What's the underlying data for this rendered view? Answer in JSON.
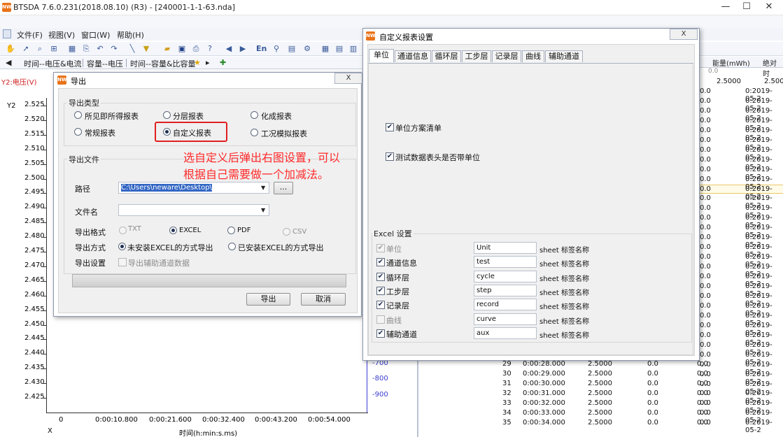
{
  "app": {
    "title": "BTSDA 7.6.0.231(2018.08.10) (R3) - [240001-1-1-63.nda]",
    "icon_text": "NW",
    "menu": [
      "文件(F)",
      "视图(V)",
      "窗口(W)",
      "帮助(H)"
    ],
    "toolbar_en": "En"
  },
  "tabs": [
    "时间--电压&电流",
    "容量--电压",
    "时间--容量&比容量"
  ],
  "graph": {
    "y_title": "Y2:电压(V)",
    "y_label": "Y2",
    "yticks": [
      "2.525",
      "2.520",
      "2.515",
      "2.510",
      "2.505",
      "2.500",
      "2.495",
      "2.490",
      "2.485",
      "2.480",
      "2.475",
      "2.470",
      "2.465",
      "2.460",
      "2.455",
      "2.450",
      "2.445",
      "2.440",
      "2.435",
      "2.430",
      "2.425"
    ],
    "right_ticks": [
      "-700",
      "-800",
      "-900"
    ],
    "xticks": [
      "0",
      "0:00:10.800",
      "0:00:21.600",
      "0:00:32.400",
      "0:00:43.200",
      "0:00:54.000"
    ],
    "x_title": "时间(h:min:s.ms)",
    "x_corner": "X"
  },
  "table": {
    "headers": [
      "能量(mWh)",
      "绝对时"
    ],
    "first_row": {
      "energy": "0.0"
    },
    "second_row": {
      "voltage": "2.5000"
    },
    "date_prefix": "0.0",
    "date_cells": [
      "0:2019-05-2",
      "0:2019-05-2",
      "0:2019-05-2",
      "0:2019-05-2",
      "0:2019-05-2",
      "0:2019-05-2",
      "0:2019-05-2",
      "0:2019-05-2",
      "0:2019-05-2",
      "0:2019-05-2",
      "0:2019-05-2",
      "0:2019-05-2",
      "0:2019-05-2",
      "0:2019-05-2",
      "0:2019-05-2",
      "0:2019-05-2",
      "0:2019-05-2",
      "0:2019-05-2",
      "0:2019-05-2",
      "0:2019-05-2",
      "0:2019-05-2",
      "0:2019-05-2",
      "0:2019-05-2",
      "0:2019-05-2",
      "0:2019-05-2",
      "0:2019-05-2",
      "0:2019-05-2",
      "0:2019-05-2",
      "0:2019-05-2",
      "0:2019-05-2",
      "0:2019-05-2",
      "0:2019-05-2",
      "0:2019-05-2",
      "0:2019-05-2",
      "0:2019-05-2"
    ],
    "rows": [
      {
        "n": "29",
        "t": "0:00:28.000",
        "v": "2.5000",
        "c": "0.0",
        "e": "0.0",
        "d": "0.0:2019-05-2"
      },
      {
        "n": "30",
        "t": "0:00:29.000",
        "v": "2.5000",
        "c": "0.0",
        "e": "0.0",
        "d": "0.0:2019-05-2"
      },
      {
        "n": "31",
        "t": "0:00:30.000",
        "v": "2.5000",
        "c": "0.0",
        "e": "0.0",
        "d": "0.0:2019-05-2"
      },
      {
        "n": "32",
        "t": "0:00:31.000",
        "v": "2.5000",
        "c": "0.0",
        "e": "0.0",
        "d": "0.0:2019-05-2"
      },
      {
        "n": "33",
        "t": "0:00:32.000",
        "v": "2.5000",
        "c": "0.0",
        "e": "0.0",
        "d": "0.0:2019-05-2"
      },
      {
        "n": "34",
        "t": "0:00:33.000",
        "v": "2.5000",
        "c": "0.0",
        "e": "0.0",
        "d": "0.0:2019-05-2"
      },
      {
        "n": "35",
        "t": "0:00:34.000",
        "v": "2.5000",
        "c": "0.0",
        "e": "0.0",
        "d": "0.0:2019-05-2"
      }
    ]
  },
  "export_dialog": {
    "title": "导出",
    "close": "X",
    "type_group": "导出类型",
    "types": [
      "所见即所得报表",
      "分层报表",
      "化成报表",
      "常规报表",
      "自定义报表",
      "工况模拟报表"
    ],
    "selected_type": "自定义报表",
    "file_group": "导出文件",
    "path_label": "路径",
    "path_value": "C:\\Users\\neware\\Desktop\\",
    "browse": "...",
    "filename_label": "文件名",
    "filename_value": "",
    "format_label": "导出格式",
    "formats": [
      "TXT",
      "EXCEL",
      "PDF",
      "CSV"
    ],
    "selected_format": "EXCEL",
    "method_label": "导出方式",
    "methods": [
      "未安装EXCEL的方式导出",
      "已安装EXCEL的方式导出"
    ],
    "selected_method": "未安装EXCEL的方式导出",
    "settings_label": "导出设置",
    "aux_label": "导出辅助通道数据",
    "ok": "导出",
    "cancel": "取消"
  },
  "annotation": {
    "line1": "选自定义后弹出右图设置，可以",
    "line2": "根据自己需要做一个加减法。"
  },
  "custom_dialog": {
    "title": "自定义报表设置",
    "close": "X",
    "tabs": [
      "单位",
      "通道信息",
      "循环层",
      "工步层",
      "记录层",
      "曲线",
      "辅助通道"
    ],
    "active_tab": "单位",
    "opt1": "单位方案清单",
    "opt2": "测试数据表头是否带单位",
    "excel_group": "Excel 设置",
    "sheets": [
      {
        "label": "单位",
        "value": "Unit",
        "suffix": "sheet 标签名称",
        "checked": true,
        "disabled": true
      },
      {
        "label": "通道信息",
        "value": "test",
        "suffix": "sheet 标签名称",
        "checked": true,
        "disabled": false
      },
      {
        "label": "循环层",
        "value": "cycle",
        "suffix": "sheet 标签名称",
        "checked": true,
        "disabled": false
      },
      {
        "label": "工步层",
        "value": "step",
        "suffix": "sheet 标签名称",
        "checked": true,
        "disabled": false
      },
      {
        "label": "记录层",
        "value": "record",
        "suffix": "sheet 标签名称",
        "checked": true,
        "disabled": false
      },
      {
        "label": "曲线",
        "value": "curve",
        "suffix": "sheet 标签名称",
        "checked": false,
        "disabled": true
      },
      {
        "label": "辅助通道",
        "value": "aux",
        "suffix": "sheet 标签名称",
        "checked": true,
        "disabled": false
      }
    ]
  },
  "colors": {
    "accent_red": "#e02020",
    "annot": "#ff2a2a",
    "axis_blue": "#3b3bd0"
  }
}
